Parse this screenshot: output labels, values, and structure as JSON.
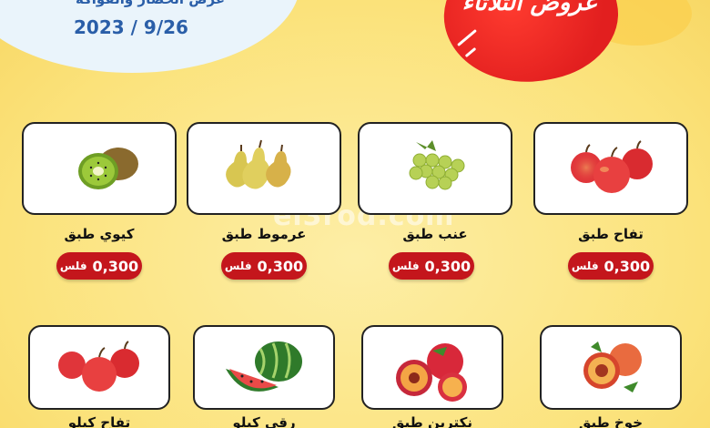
{
  "header": {
    "title_partial": "عرض الخضار والفواكه",
    "date": "2023 / 9/26",
    "offer_title": "عروض الثلاثاء"
  },
  "watermark": "el3rod.com",
  "currency": "فلس",
  "products": [
    {
      "name": "تفاح طبق",
      "price": "0,300",
      "icon": "apple-icon"
    },
    {
      "name": "عنب طبق",
      "price": "0,300",
      "icon": "grapes-icon"
    },
    {
      "name": "عرموط طبق",
      "price": "0,300",
      "icon": "pear-icon"
    },
    {
      "name": "كيوي طبق",
      "price": "0,300",
      "icon": "kiwi-icon"
    },
    {
      "name": "خوخ طبق",
      "icon": "peach-icon"
    },
    {
      "name": "نكترين طبق",
      "icon": "nectarine-icon"
    },
    {
      "name": "رقي كيلو",
      "icon": "watermelon-icon"
    },
    {
      "name": "تفاح كيلو",
      "icon": "apple-icon"
    }
  ],
  "colors": {
    "background": "#fbe68c",
    "price_badge": "#c4161c",
    "offer_blob": "#e21f1f",
    "date_text": "#2a5ea8"
  }
}
